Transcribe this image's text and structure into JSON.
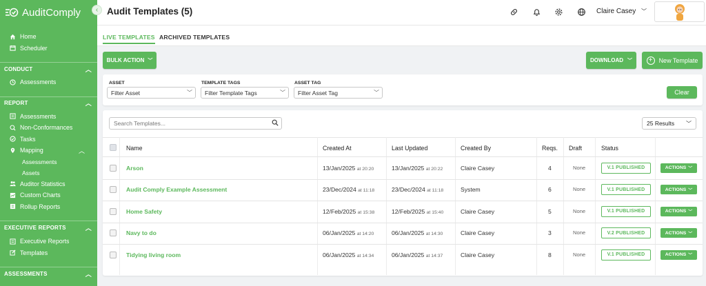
{
  "app": {
    "name": "AuditComply"
  },
  "sidebar": {
    "top_items": [
      {
        "label": "Home",
        "icon": "home-icon"
      },
      {
        "label": "Scheduler",
        "icon": "calendar-icon"
      }
    ],
    "conduct": {
      "title": "CONDUCT",
      "items": [
        {
          "label": "Assessments",
          "icon": "clock-icon"
        }
      ]
    },
    "report": {
      "title": "REPORT",
      "items": [
        {
          "label": "Assessments",
          "icon": "list-icon"
        },
        {
          "label": "Non-Conformances",
          "icon": "search-alert-icon"
        },
        {
          "label": "Tasks",
          "icon": "check-circle-icon"
        },
        {
          "label": "Mapping",
          "icon": "map-pin-icon"
        }
      ],
      "mapping_sub": [
        "Assessments",
        "Assets"
      ],
      "items_after": [
        {
          "label": "Auditor Statistics",
          "icon": "people-icon"
        },
        {
          "label": "Custom Charts",
          "icon": "chart-icon"
        },
        {
          "label": "Rollup Reports",
          "icon": "rollup-icon"
        }
      ]
    },
    "executive": {
      "title": "EXECUTIVE REPORTS",
      "items": [
        {
          "label": "Executive Reports",
          "icon": "list-icon"
        },
        {
          "label": "Templates",
          "icon": "edit-icon"
        }
      ]
    },
    "assessments": {
      "title": "ASSESSMENTS"
    }
  },
  "header": {
    "title": "Audit Templates (5)",
    "user_name": "Claire Casey"
  },
  "tabs": [
    {
      "label": "LIVE TEMPLATES"
    },
    {
      "label": "ARCHIVED TEMPLATES"
    }
  ],
  "toolbar": {
    "bulk_action": "BULK ACTION",
    "download": "DOWNLOAD",
    "new_template": "New Template"
  },
  "filters": {
    "asset": {
      "label": "ASSET",
      "value": "Filter Asset"
    },
    "template_tags": {
      "label": "TEMPLATE TAGS",
      "value": "Filter Template Tags"
    },
    "asset_tag": {
      "label": "ASSET TAG",
      "value": "Filter Asset Tag"
    },
    "clear": "Clear"
  },
  "table": {
    "search_placeholder": "Search Templates...",
    "results": "25 Results",
    "columns": [
      "Name",
      "Created At",
      "Last Updated",
      "Created By",
      "Reqs.",
      "Draft",
      "Status"
    ],
    "rows": [
      {
        "name": "Arson",
        "created_date": "13/Jan/2025",
        "created_time": "at 20:20",
        "updated_date": "13/Jan/2025",
        "updated_time": "at 20:22",
        "created_by": "Claire Casey",
        "reqs": "4",
        "draft": "None",
        "status": "V.1 PUBLISHED",
        "actions": "ACTIONS"
      },
      {
        "name": "Audit Comply Example Assessment",
        "created_date": "23/Dec/2024",
        "created_time": "at 11:18",
        "updated_date": "23/Dec/2024",
        "updated_time": "at 11:18",
        "created_by": "System",
        "reqs": "6",
        "draft": "None",
        "status": "V.1 PUBLISHED",
        "actions": "ACTIONS"
      },
      {
        "name": "Home Safety",
        "created_date": "12/Feb/2025",
        "created_time": "at 15:38",
        "updated_date": "12/Feb/2025",
        "updated_time": "at 15:40",
        "created_by": "Claire Casey",
        "reqs": "5",
        "draft": "None",
        "status": "V.1 PUBLISHED",
        "actions": "ACTIONS"
      },
      {
        "name": "Navy to do",
        "created_date": "06/Jan/2025",
        "created_time": "at 14:20",
        "updated_date": "06/Jan/2025",
        "updated_time": "at 14:30",
        "created_by": "Claire Casey",
        "reqs": "3",
        "draft": "None",
        "status": "V.2 PUBLISHED",
        "actions": "ACTIONS"
      },
      {
        "name": "Tidying living room",
        "created_date": "06/Jan/2025",
        "created_time": "at 14:34",
        "updated_date": "06/Jan/2025",
        "updated_time": "at 14:37",
        "created_by": "Claire Casey",
        "reqs": "8",
        "draft": "None",
        "status": "V.1 PUBLISHED",
        "actions": "ACTIONS"
      }
    ]
  },
  "colors": {
    "brand_green": "#5cb85c",
    "background": "#f0f2f4"
  }
}
